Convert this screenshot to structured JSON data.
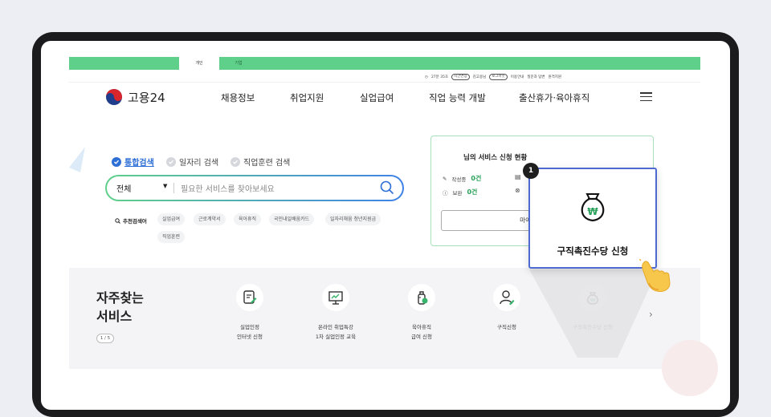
{
  "topbar": {
    "tab_personal": "개인",
    "tab_corporate": "기업"
  },
  "utility": {
    "timer": "27분 35초",
    "extend": "시간연장",
    "user": "김고용님",
    "logout": "로그아웃",
    "links": [
      "이용안내",
      "질문과 답변",
      "원격지원"
    ]
  },
  "nav": {
    "logo_text": "고용24",
    "items": [
      "채용정보",
      "취업지원",
      "실업급여",
      "직업 능력 개발",
      "출산휴가·육아휴직"
    ]
  },
  "search": {
    "options": [
      "통합검색",
      "일자리 검색",
      "직업훈련 검색"
    ],
    "scope": "전체",
    "placeholder": "필요한 서비스를 찾아보세요",
    "recommend_label": "추천검색어",
    "keywords": [
      "실업급여",
      "근로계약서",
      "육아휴직",
      "국민내일배움카드",
      "일자리채움 청년지원금",
      "직업훈련"
    ]
  },
  "status": {
    "title": "님의 서비스 신청 현황",
    "rows": [
      {
        "label": "작성중",
        "count": "0건"
      },
      {
        "label": "보완",
        "count": "0건"
      }
    ],
    "my_button": "마이"
  },
  "callout": {
    "badge": "1",
    "label": "구직촉진수당 신청"
  },
  "frequent": {
    "title": "자주찾는\n서비스",
    "pager": "1 / 5",
    "items": [
      {
        "label": "실업인정\n인터넷 신청",
        "icon": "document-pen-icon"
      },
      {
        "label": "온라인 취업특강\n1차 실업인정 교육",
        "icon": "presentation-board-icon"
      },
      {
        "label": "육아휴직\n급여 신청",
        "icon": "baby-bottle-icon"
      },
      {
        "label": "구직신청",
        "icon": "person-pen-icon"
      },
      {
        "label": "구직촉진수당 신청",
        "icon": "money-bag-icon"
      }
    ]
  },
  "colors": {
    "brand_green": "#5fd08a",
    "brand_blue": "#3f82e6",
    "highlight": "#4e6ad1"
  }
}
